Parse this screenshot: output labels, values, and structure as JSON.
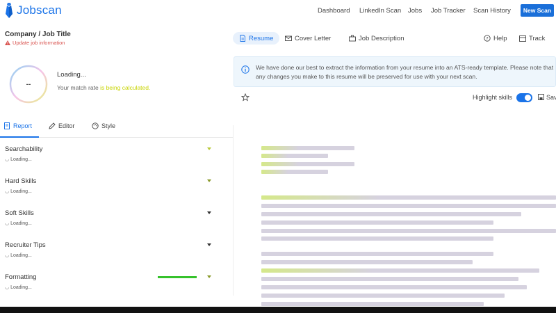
{
  "brand": {
    "name": "Jobscan",
    "color": "#1a73e8"
  },
  "nav": {
    "dashboard": "Dashboard",
    "linkedin_scan": "LinkedIn Scan",
    "jobs": "Jobs",
    "job_tracker": "Job Tracker",
    "scan_history": "Scan History",
    "new_scan": "New Scan"
  },
  "job": {
    "title": "Company / Job Title",
    "update_link": "Update job information"
  },
  "score": {
    "value": "--",
    "loading": "Loading...",
    "match_rate_prefix": "Your match rate ",
    "match_rate_highlight": "is being calculated."
  },
  "report_tabs": {
    "report": "Report",
    "editor": "Editor",
    "style": "Style"
  },
  "sections": [
    {
      "title": "Searchability",
      "status": "Loading..."
    },
    {
      "title": "Hard Skills",
      "status": "Loading..."
    },
    {
      "title": "Soft Skills",
      "status": "Loading..."
    },
    {
      "title": "Recruiter Tips",
      "status": "Loading..."
    },
    {
      "title": "Formatting",
      "status": "Loading..."
    }
  ],
  "doc_tabs": {
    "resume": "Resume",
    "cover_letter": "Cover Letter",
    "job_description": "Job Description",
    "help": "Help",
    "track": "Track"
  },
  "info": {
    "text": "We have done our best to extract the information from your resume into an ATS-ready template. Please note that any changes you make to this resume will be preserved for use with your next scan."
  },
  "toolbar": {
    "highlight_skills": "Highlight skills",
    "save": "Save",
    "highlight_enabled": true
  },
  "colors": {
    "accent": "#1a73e8",
    "warning": "#d9534f",
    "skeleton": "#d6d2df",
    "info_bg": "#eef6fc"
  }
}
